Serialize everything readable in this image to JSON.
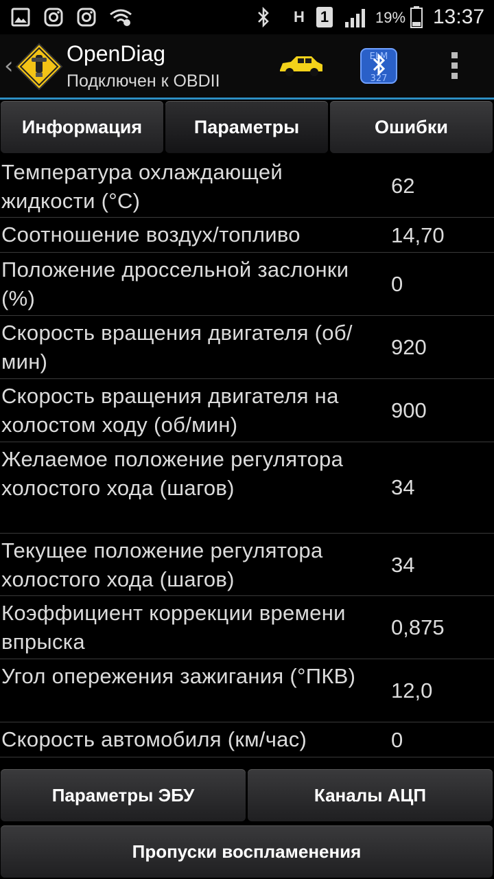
{
  "status_bar": {
    "time": "13:37",
    "battery_percent": "19%",
    "sim_slot": "1",
    "network_letter": "H",
    "icons": [
      "gallery-icon",
      "instagram-icon",
      "instagram-icon",
      "wifi-icon",
      "bluetooth-icon",
      "signal-icon",
      "battery-icon"
    ]
  },
  "action_bar": {
    "title": "OpenDiag",
    "subtitle": "Подключен к OBDII",
    "icons": [
      "back-chevron-icon",
      "app-logo-icon",
      "car-icon",
      "bluetooth-elm-icon",
      "overflow-menu-icon"
    ],
    "accent_color": "#2d8fc4"
  },
  "tabs": [
    {
      "label": "Информация",
      "active": false
    },
    {
      "label": "Параметры",
      "active": true
    },
    {
      "label": "Ошибки",
      "active": false
    }
  ],
  "parameters": [
    {
      "name": "Температура охлаждающей жидкости (°C)",
      "value": "62"
    },
    {
      "name": "Соотношение воздух/топливо",
      "value": "14,70"
    },
    {
      "name": "Положение дроссельной заслонки (%)",
      "value": "0"
    },
    {
      "name": "Скорость вращения двигателя (об/мин)",
      "value": "920"
    },
    {
      "name": "Скорость вращения двигателя на холостом ходу (об/мин)",
      "value": "900"
    },
    {
      "name": "Желаемое положение регулятора холостого хода (шагов)",
      "value": "34"
    },
    {
      "name": "Текущее положение регулятора холостого хода (шагов)",
      "value": "34"
    },
    {
      "name": "Коэффициент коррекции времени впрыска",
      "value": "0,875"
    },
    {
      "name": "Угол опережения зажигания (°ПКВ)",
      "value": "12,0"
    },
    {
      "name": "Скорость автомобиля (км/час)",
      "value": "0"
    }
  ],
  "bottom_buttons": {
    "ecu_params": "Параметры ЭБУ",
    "adc_channels": "Каналы АЦП",
    "misfires": "Пропуски воспламенения"
  }
}
